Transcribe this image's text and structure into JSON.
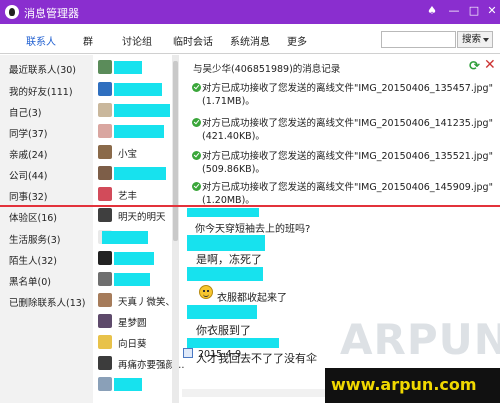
{
  "window": {
    "title": "消息管理器"
  },
  "nav": {
    "tabs": [
      {
        "label": "联系人"
      },
      {
        "label": "群"
      },
      {
        "label": "讨论组"
      },
      {
        "label": "临时会话"
      },
      {
        "label": "系统消息"
      },
      {
        "label": "更多"
      }
    ],
    "search": {
      "value": "",
      "button_label": "搜索"
    }
  },
  "groups": [
    {
      "label": "最近联系人(30)"
    },
    {
      "label": "我的好友(111)"
    },
    {
      "label": "自己(3)"
    },
    {
      "label": "同学(37)"
    },
    {
      "label": "亲戚(24)"
    },
    {
      "label": "公司(44)"
    },
    {
      "label": "同事(32)"
    },
    {
      "label": "体验区(16)"
    },
    {
      "label": "生活服务(3)"
    },
    {
      "label": "陌生人(32)"
    },
    {
      "label": "黑名单(0)"
    },
    {
      "label": "已删除联系人(13)"
    }
  ],
  "contacts": [
    {
      "name": ""
    },
    {
      "name": ""
    },
    {
      "name": ""
    },
    {
      "name": ""
    },
    {
      "name": "小宝"
    },
    {
      "name": ""
    },
    {
      "name": "艺丰"
    },
    {
      "name": "明天的明天"
    },
    {
      "name": ""
    },
    {
      "name": ""
    },
    {
      "name": ""
    },
    {
      "name": "天真丿微笑、"
    },
    {
      "name": "星梦圆"
    },
    {
      "name": "向日葵"
    },
    {
      "name": "再痛亦要强颜…"
    }
  ],
  "chat": {
    "header": "与吴少华(406851989)的消息记录",
    "system_messages": [
      {
        "text": "对方已成功接收了您发送的离线文件\"IMG_20150406_135457.jpg\"(1.71MB)。"
      },
      {
        "text": "对方已成功接收了您发送的离线文件\"IMG_20150406_141235.jpg\"(421.40KB)。"
      },
      {
        "text": "对方已成功接收了您发送的离线文件\"IMG_20150406_135521.jpg\"(509.86KB)。"
      },
      {
        "text": "对方已成功接收了您发送的离线文件\"IMG_20150406_145909.jpg\"(1.20MB)。"
      }
    ],
    "messages": [
      {
        "text": "你今天穿短袖去上的班吗?"
      },
      {
        "text": "是啊，冻死了"
      },
      {
        "text": "衣服都收起来了"
      },
      {
        "text": "你衣服到了"
      },
      {
        "text": "人才我回去不了了没有伞"
      }
    ],
    "date_filter": "2015-4-9"
  },
  "watermark": {
    "logo": "ARPUN",
    "url": "www.arpun.com"
  },
  "colors": {
    "titlebar": "#8a2ecf",
    "accent": "#1f5fd1",
    "divider": "#e3323b",
    "redaction": "#17e2ee",
    "watermark_url": "#f0d800"
  }
}
